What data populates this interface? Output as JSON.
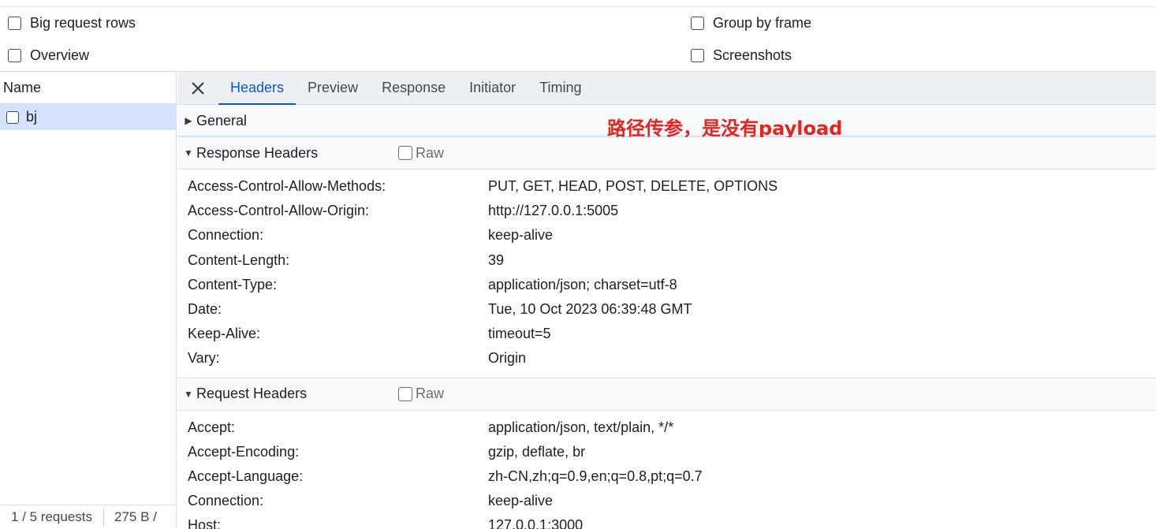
{
  "settings": {
    "big_request_rows": "Big request rows",
    "overview": "Overview",
    "group_by_frame": "Group by frame",
    "screenshots": "Screenshots"
  },
  "left": {
    "column_header": "Name",
    "requests": [
      {
        "name": "bj"
      }
    ],
    "footer": {
      "requests": "1 / 5 requests",
      "size": "275 B / "
    }
  },
  "tabs": [
    "Headers",
    "Preview",
    "Response",
    "Initiator",
    "Timing"
  ],
  "active_tab": "Headers",
  "sections": {
    "general": {
      "title": "General",
      "annotation": "路径传参，是没有payload"
    },
    "response_headers": {
      "title": "Response Headers",
      "raw_label": "Raw",
      "items": [
        {
          "name": "Access-Control-Allow-Methods:",
          "value": "PUT, GET, HEAD, POST, DELETE, OPTIONS"
        },
        {
          "name": "Access-Control-Allow-Origin:",
          "value": "http://127.0.0.1:5005"
        },
        {
          "name": "Connection:",
          "value": "keep-alive"
        },
        {
          "name": "Content-Length:",
          "value": "39"
        },
        {
          "name": "Content-Type:",
          "value": "application/json; charset=utf-8"
        },
        {
          "name": "Date:",
          "value": "Tue, 10 Oct 2023 06:39:48 GMT"
        },
        {
          "name": "Keep-Alive:",
          "value": "timeout=5"
        },
        {
          "name": "Vary:",
          "value": "Origin"
        }
      ]
    },
    "request_headers": {
      "title": "Request Headers",
      "raw_label": "Raw",
      "items": [
        {
          "name": "Accept:",
          "value": "application/json, text/plain, */*"
        },
        {
          "name": "Accept-Encoding:",
          "value": "gzip, deflate, br"
        },
        {
          "name": "Accept-Language:",
          "value": "zh-CN,zh;q=0.9,en;q=0.8,pt;q=0.7"
        },
        {
          "name": "Connection:",
          "value": "keep-alive"
        },
        {
          "name": "Host:",
          "value": "127.0.0.1:3000"
        }
      ]
    }
  },
  "colors": {
    "accent": "#0b57d0",
    "selected_row": "#d3e3fd",
    "annotation": "#e8231e"
  }
}
